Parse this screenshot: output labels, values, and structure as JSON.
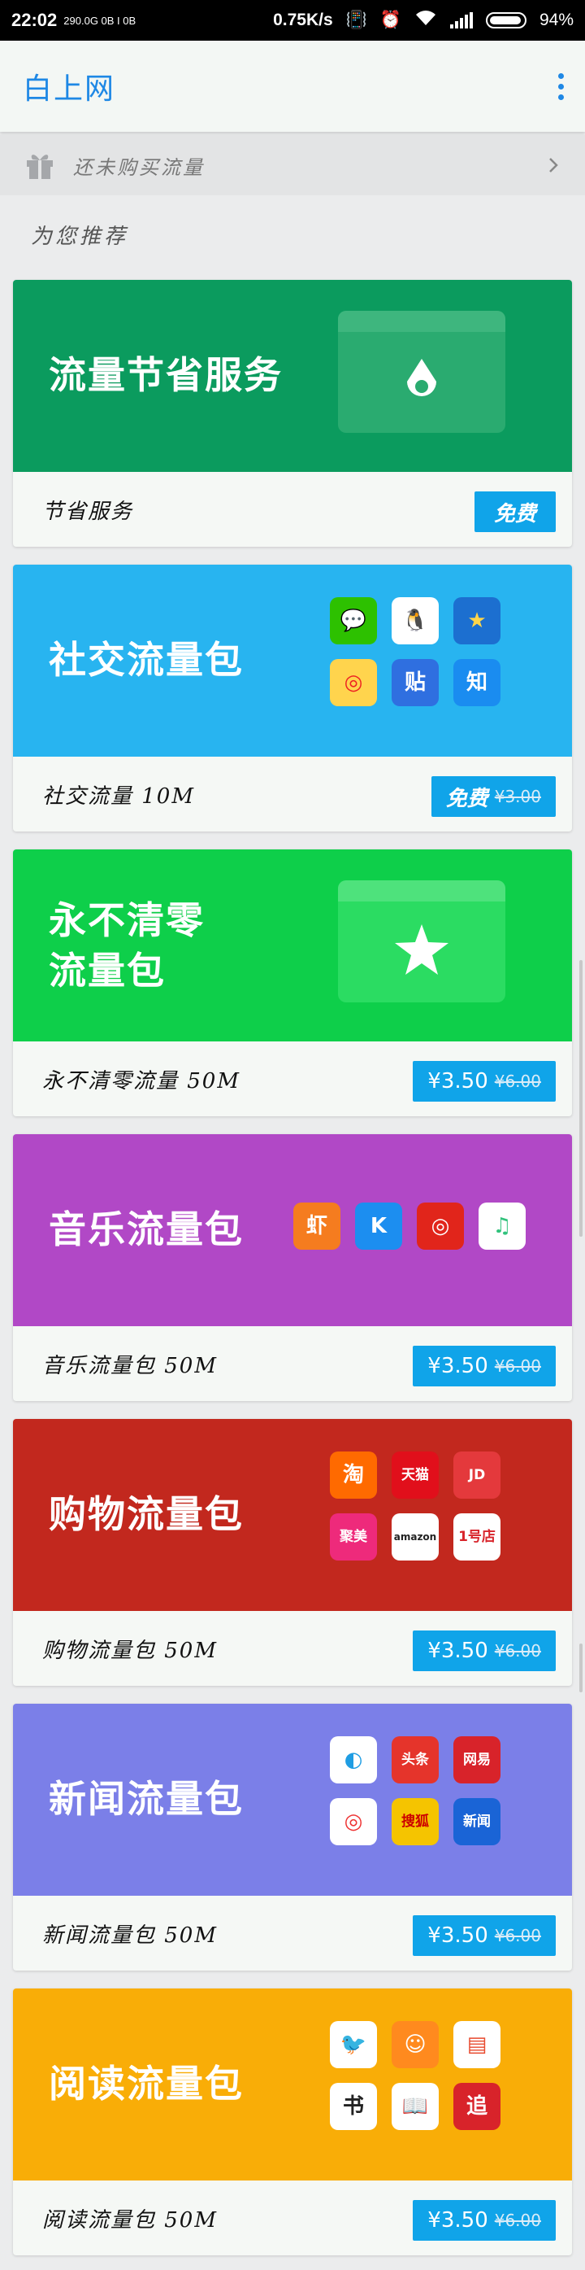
{
  "status_bar": {
    "time": "22:02",
    "network": "290.0G 0B I 0B",
    "speed": "0.75K/s",
    "battery": "94%"
  },
  "app_bar": {
    "title": "白上网"
  },
  "promo": {
    "text": "还未购买流量"
  },
  "section": {
    "title": "为您推荐"
  },
  "cards": [
    {
      "title": "流量节省服务",
      "footer": "节省服务",
      "price": "免费",
      "old_price": "",
      "color": "#0b9b5e",
      "footer_color": "#f5f8f5"
    },
    {
      "title": "社交流量包",
      "footer": "社交流量 10M",
      "price": "免费",
      "old_price": "¥3.00",
      "color": "#28b4f0",
      "apps": [
        "wechat-icon",
        "qq-icon",
        "qzone-icon",
        "weibo-icon",
        "tieba-icon",
        "zhihu-icon"
      ],
      "app_labels": [
        "💬",
        "🐧",
        "★",
        "◎",
        "贴",
        "知"
      ]
    },
    {
      "title_line1": "永不清零",
      "title_line2": "流量包",
      "footer": "永不清零流量 50M",
      "price": "¥3.50",
      "old_price": "¥6.00",
      "color": "#0ecf4a"
    },
    {
      "title": "音乐流量包",
      "footer": "音乐流量包 50M",
      "price": "¥3.50",
      "old_price": "¥6.00",
      "color": "#b148c6",
      "apps": [
        "xiami-icon",
        "kugou-icon",
        "netease-music-icon",
        "qq-music-icon"
      ],
      "app_labels": [
        "虾",
        "K",
        "◎",
        "♫"
      ]
    },
    {
      "title": "购物流量包",
      "footer": "购物流量包 50M",
      "price": "¥3.50",
      "old_price": "¥6.00",
      "color": "#c2281e",
      "apps": [
        "taobao-icon",
        "tmall-icon",
        "jd-icon",
        "jumei-icon",
        "amazon-icon",
        "yhd-icon"
      ],
      "app_labels": [
        "淘",
        "天猫",
        "JD",
        "聚美",
        "amazon",
        "1号店"
      ]
    },
    {
      "title": "新闻流量包",
      "footer": "新闻流量包 50M",
      "price": "¥3.50",
      "old_price": "¥6.00",
      "color": "#7b7fe8",
      "apps": [
        "tencent-news-icon",
        "toutiao-icon",
        "netease-news-icon",
        "ifeng-icon",
        "sohu-icon",
        "sina-news-icon"
      ],
      "app_labels": [
        "◐",
        "头条",
        "网易",
        "◎",
        "搜狐",
        "新闻"
      ]
    },
    {
      "title": "阅读流量包",
      "footer": "阅读流量包 50M",
      "price": "¥3.50",
      "old_price": "¥6.00",
      "color": "#f9ad07",
      "apps": [
        "bird-icon",
        "face-icon",
        "book-icon",
        "novel-icon",
        "qq-reader-icon",
        "zhui-icon"
      ],
      "app_labels": [
        "🐦",
        "☺",
        "▤",
        "书",
        "📖",
        "追"
      ]
    }
  ]
}
